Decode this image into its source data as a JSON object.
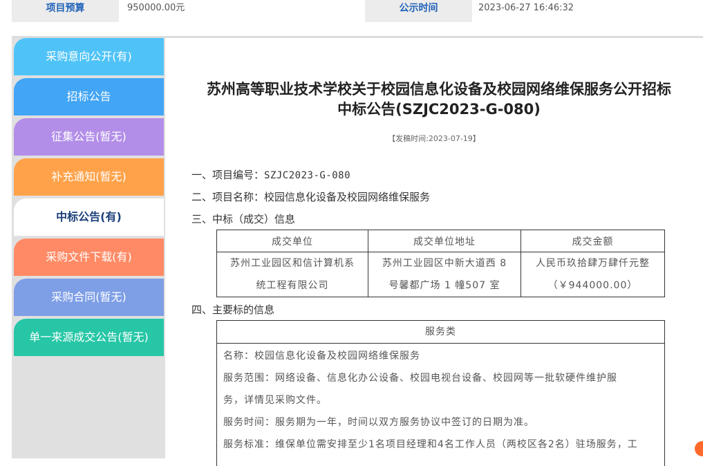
{
  "top": {
    "budget_label": "项目预算",
    "budget_value": "950000.00元",
    "publish_label": "公示时间",
    "publish_value": "2023-06-27 16:46:32"
  },
  "sidebar": {
    "items": [
      {
        "label": "采购意向公开(有)",
        "color": "#4fc3f7"
      },
      {
        "label": "招标公告",
        "color": "#42a5f5"
      },
      {
        "label": "征集公告(暂无)",
        "color": "#b28ee8"
      },
      {
        "label": "补充通知(暂无)",
        "color": "#ffa24a"
      },
      {
        "label": "中标公告(有)",
        "color": "#ffffff"
      },
      {
        "label": "采购文件下载(有)",
        "color": "#ff8a65"
      },
      {
        "label": "采购合同(暂无)",
        "color": "#7e9ee6"
      },
      {
        "label": "单一来源成交公告(暂无)",
        "color": "#26c6a6"
      }
    ]
  },
  "notice": {
    "title_line1": "苏州高等职业技术学校关于校园信息化设备及校园网络维保服务公开招标",
    "title_line2": "中标公告(SZJC2023-G-080)",
    "post_date": "【发稿时间:2023-07-19】",
    "s1_label": "一、项目编号：",
    "s1_value": "SZJC2023-G-080",
    "s2_label": "二、项目名称：",
    "s2_value": "校园信息化设备及校园网络维保服务",
    "s3": "三、中标（成交）信息",
    "s4": "四、主要标的信息"
  },
  "award_table": {
    "headers": [
      "成交单位",
      "成交单位地址",
      "成交金额"
    ],
    "row_line1": [
      "苏州工业园区和信计算机系",
      "苏州工业园区中新大道西 8",
      "人民币玖拾肆万肆仟元整"
    ],
    "row_line2": [
      "统工程有限公司",
      "号馨都广场 1 幢507 室",
      "（￥944000.00）"
    ]
  },
  "service": {
    "header": "服务类",
    "lines": [
      "名称：校园信息化设备及校园网络维保服务",
      "服务范围：网络设备、信息化办公设备、校园电视台设备、校园网等一批软硬件维护服",
      "务，详情见采购文件。",
      "服务时间：服务期为一年，时间以双方服务协议中签订的日期为准。",
      "服务标准：维保单位需安排至少1名项目经理和4名工作人员（两校区各2名）驻场服务，工"
    ]
  }
}
